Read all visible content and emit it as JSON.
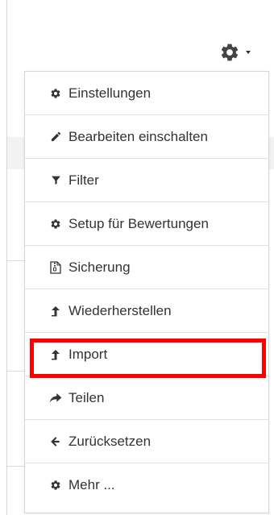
{
  "toolbar": {
    "gear_icon": "gear-icon",
    "caret_icon": "caret-down-icon"
  },
  "menu": {
    "items": [
      {
        "label": "Einstellungen",
        "icon": "gear-icon"
      },
      {
        "label": "Bearbeiten einschalten",
        "icon": "pencil-icon"
      },
      {
        "label": "Filter",
        "icon": "filter-icon"
      },
      {
        "label": "Setup für Bewertungen",
        "icon": "gear-icon"
      },
      {
        "label": "Sicherung",
        "icon": "file-archive-icon"
      },
      {
        "label": "Wiederherstellen",
        "icon": "upload-arrow-icon"
      },
      {
        "label": "Import",
        "icon": "upload-arrow-icon"
      },
      {
        "label": "Teilen",
        "icon": "share-icon"
      },
      {
        "label": "Zurücksetzen",
        "icon": "arrow-left-icon"
      },
      {
        "label": "Mehr ...",
        "icon": "gear-icon"
      }
    ]
  },
  "colors": {
    "highlight": "#ff0000",
    "icon": "#333333",
    "text": "#333333"
  }
}
